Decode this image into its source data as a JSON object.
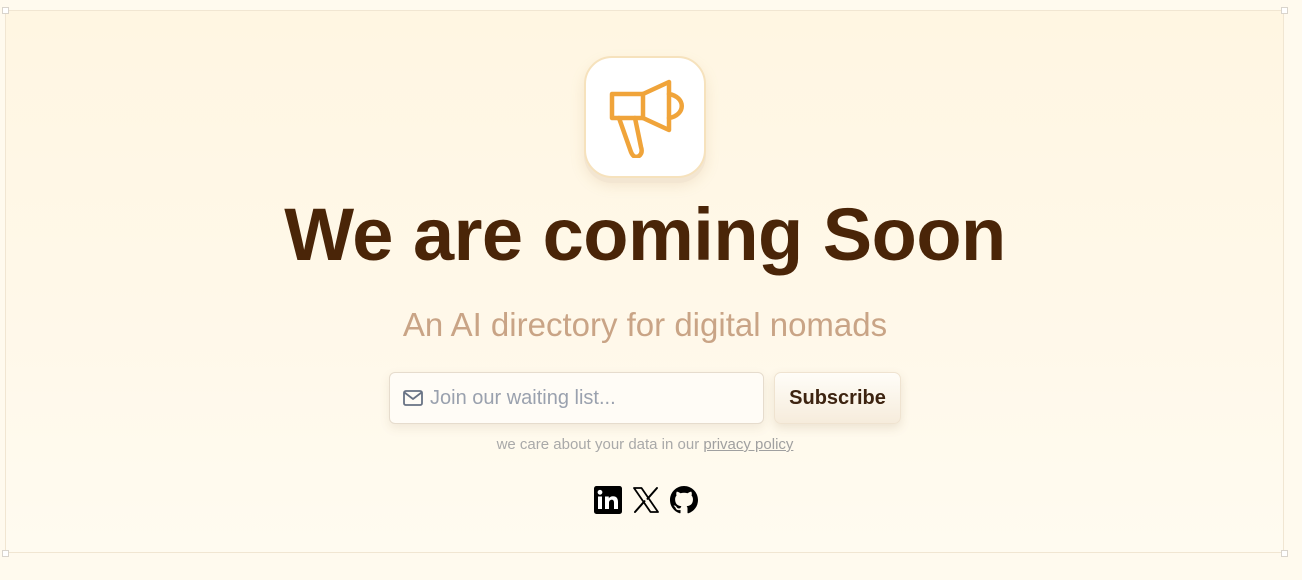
{
  "hero": {
    "logo_icon": "megaphone-icon",
    "title": "We are coming Soon",
    "subtitle": "An AI directory for digital nomads"
  },
  "signup": {
    "email_icon": "mail-icon",
    "email_placeholder": "Join our waiting list...",
    "email_value": "",
    "subscribe_label": "Subscribe",
    "privacy_text": "we care about your data in our",
    "privacy_link": "privacy policy"
  },
  "social": [
    {
      "icon": "linkedin-icon"
    },
    {
      "icon": "x-icon"
    },
    {
      "icon": "github-icon"
    }
  ],
  "colors": {
    "accent": "#f0a43a",
    "title": "#4a2508",
    "subtitle": "#c9a486",
    "background": "#fff6e2"
  }
}
